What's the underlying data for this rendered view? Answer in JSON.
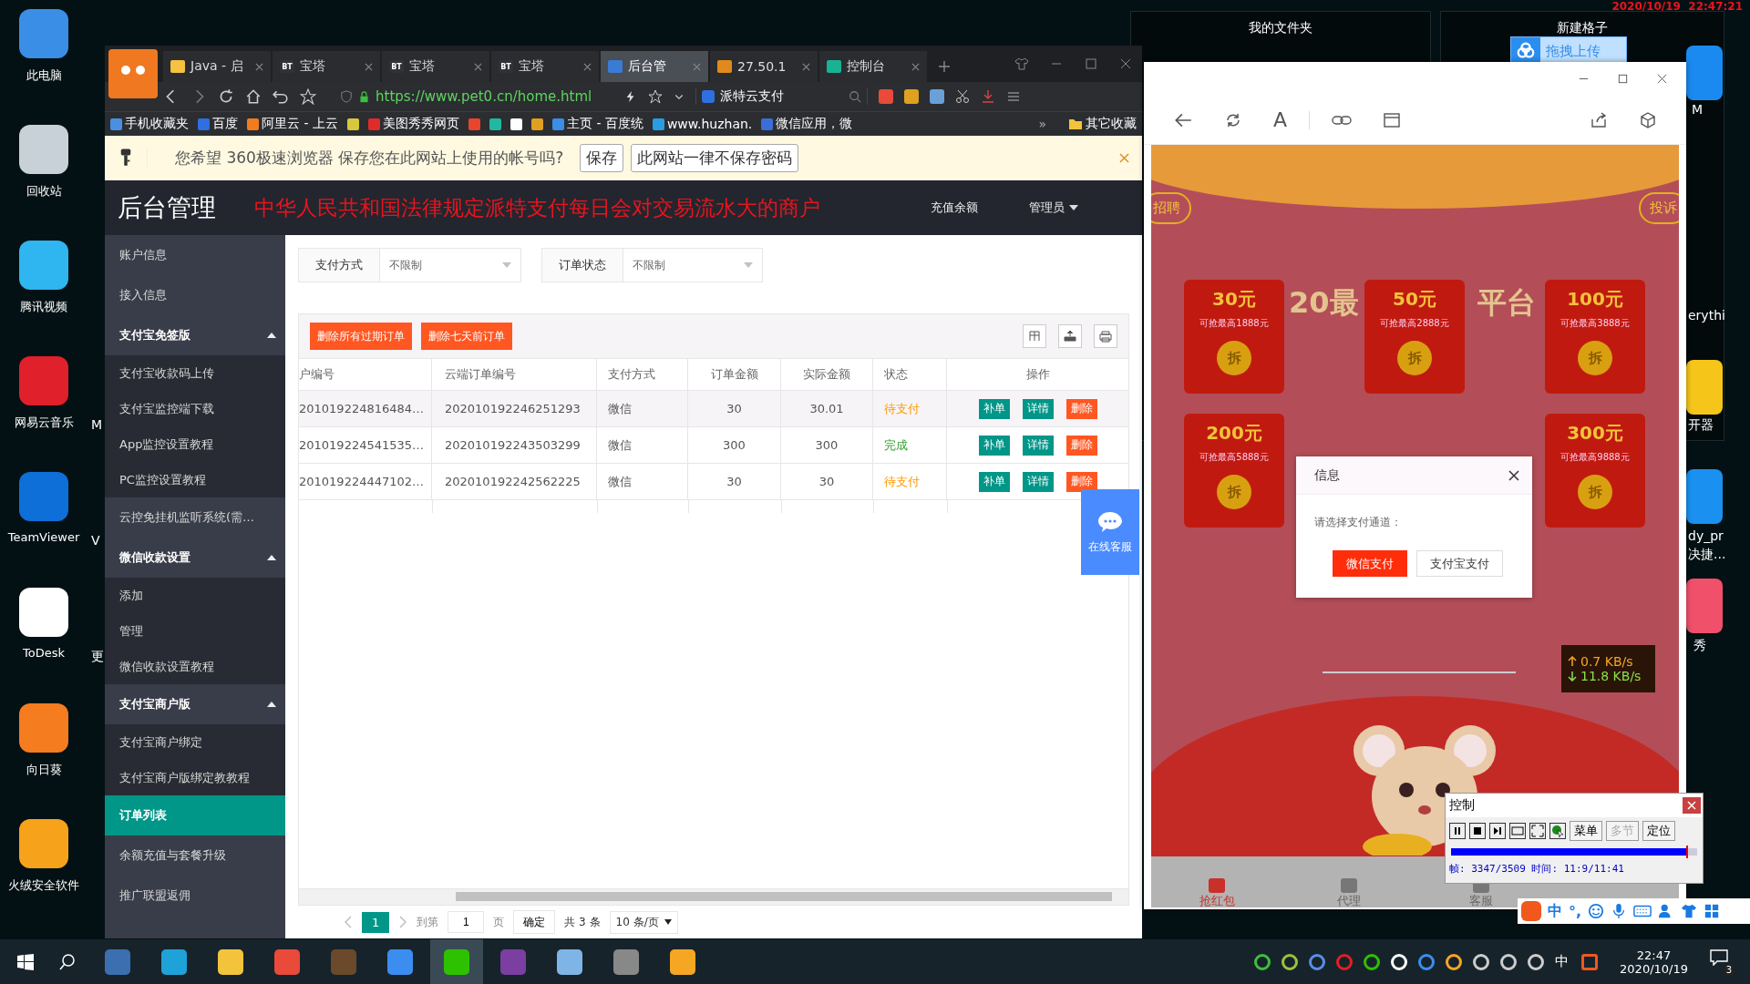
{
  "desktop": {
    "icons": [
      {
        "label": "此电脑",
        "kind": "pc"
      },
      {
        "label": "回收站",
        "kind": "bin"
      },
      {
        "label": "腾讯视频",
        "kind": "video"
      },
      {
        "label": "网易云音乐",
        "kind": "music"
      },
      {
        "label": "TeamViewer",
        "kind": "remote"
      },
      {
        "label": "ToDesk",
        "kind": "desk"
      },
      {
        "label": "向日葵",
        "kind": "sun"
      },
      {
        "label": "火绒安全软件",
        "kind": "shield"
      }
    ],
    "left_fragments": [
      "M",
      "V",
      "更"
    ],
    "right_fragments": [
      "M",
      "erythi",
      "开器",
      "dy_pr",
      "决捷...",
      "秀"
    ],
    "clock_overlay": "2020/10/19  22:47:21",
    "panels": [
      {
        "title": "我的文件夹"
      },
      {
        "title": "新建格子"
      }
    ],
    "upload_button": "拖拽上传"
  },
  "browser": {
    "tabs": [
      {
        "label": "Java - 启",
        "kind": "java",
        "selected": false
      },
      {
        "label": "宝塔",
        "kind": "bt",
        "icon_text": "BT",
        "selected": false
      },
      {
        "label": "宝塔",
        "kind": "bt",
        "icon_text": "BT",
        "selected": false
      },
      {
        "label": "宝塔",
        "kind": "bt",
        "icon_text": "BT",
        "selected": false
      },
      {
        "label": "后台管",
        "kind": "pay",
        "selected": true
      },
      {
        "label": "27.50.1",
        "kind": "peak",
        "selected": false
      },
      {
        "label": "控制台",
        "kind": "bolt",
        "selected": false
      }
    ],
    "url": "https://www.pet0.cn/home.html",
    "search": "派特云支付",
    "bookmarks": [
      {
        "kind": "phone",
        "label": "手机收藏夹"
      },
      {
        "kind": "paw",
        "label": "百度"
      },
      {
        "kind": "cloud",
        "label": "阿里云 - 上云"
      },
      {
        "kind": "gem"
      },
      {
        "kind": "seal",
        "label": "美图秀秀网页"
      },
      {
        "kind": "skull"
      },
      {
        "kind": "leaf"
      },
      {
        "kind": "page"
      },
      {
        "kind": "cube"
      },
      {
        "kind": "chart",
        "label": "主页 - 百度统"
      },
      {
        "kind": "site",
        "label": "www.huzhan."
      },
      {
        "kind": "letter",
        "label": "微信应用，微"
      }
    ],
    "more": "»",
    "other_bookmarks": "其它收藏",
    "save_prompt": {
      "message": "您希望 360极速浏览器 保存您在此网站上使用的帐号吗?",
      "buttons": [
        "保存",
        "此网站一律不保存密码"
      ]
    }
  },
  "app": {
    "title": "后台管理",
    "notice": "中华人民共和国法律规定派特支付每日会对交易流水大的商户",
    "header_links": [
      "充值余额"
    ],
    "user": "管理员",
    "sidebar": [
      {
        "label": "账户信息",
        "selected": false
      },
      {
        "label": "接入信息",
        "selected": false
      },
      {
        "label": "支付宝免签版",
        "selected": false,
        "expanded": true,
        "children": [
          {
            "label": "支付宝收款码上传",
            "selected": false
          },
          {
            "label": "支付宝监控端下载",
            "selected": false
          },
          {
            "label": "App监控设置教程",
            "selected": false
          },
          {
            "label": "PC监控设置教程",
            "selected": false
          }
        ]
      },
      {
        "label": "云控免挂机监听系统(需…",
        "selected": false
      },
      {
        "label": "微信收款设置",
        "selected": false,
        "expanded": true,
        "children": [
          {
            "label": "添加",
            "selected": false
          },
          {
            "label": "管理",
            "selected": false
          },
          {
            "label": "微信收款设置教程",
            "selected": false
          }
        ]
      },
      {
        "label": "支付宝商户版",
        "selected": false,
        "expanded": true,
        "children": [
          {
            "label": "支付宝商户绑定",
            "selected": false
          },
          {
            "label": "支付宝商户版绑定教教程",
            "selected": false
          }
        ]
      },
      {
        "label": "订单列表",
        "selected": true
      },
      {
        "label": "余额充值与套餐升级",
        "selected": false
      },
      {
        "label": "推广联盟返佣",
        "selected": false
      }
    ],
    "filters": [
      {
        "label": "支付方式",
        "value": "不限制"
      },
      {
        "label": "订单状态",
        "value": "不限制"
      }
    ],
    "actions": [
      "删除所有过期订单",
      "删除七天前订单"
    ],
    "table": {
      "columns": [
        "户编号",
        "云端订单编号",
        "支付方式",
        "订单金额",
        "实际金额",
        "状态",
        "操作"
      ],
      "rows": [
        {
          "cells": [
            "201019224816484…",
            "202010192246251293",
            "微信",
            "30",
            "30.01"
          ],
          "status": {
            "text": "待支付",
            "kind": "pending"
          },
          "actions": [
            {
              "label": "补单",
              "kind": "supplement"
            },
            {
              "label": "详情",
              "kind": "detail"
            },
            {
              "label": "删除",
              "kind": "delete"
            }
          ]
        },
        {
          "cells": [
            "201019224541535…",
            "202010192243503299",
            "微信",
            "300",
            "300"
          ],
          "status": {
            "text": "完成",
            "kind": "done"
          },
          "actions": [
            {
              "label": "补单",
              "kind": "supplement"
            },
            {
              "label": "详情",
              "kind": "detail"
            },
            {
              "label": "删除",
              "kind": "delete"
            }
          ]
        },
        {
          "cells": [
            "201019224447102…",
            "202010192242562225",
            "微信",
            "30",
            "30"
          ],
          "status": {
            "text": "待支付",
            "kind": "pending"
          },
          "actions": [
            {
              "label": "补单",
              "kind": "supplement"
            },
            {
              "label": "详情",
              "kind": "detail"
            },
            {
              "label": "删除",
              "kind": "delete"
            }
          ]
        }
      ]
    },
    "pagination": {
      "current": "1",
      "goto_label": "到第",
      "goto_value": "1",
      "page_unit": "页",
      "confirm": "确定",
      "total": "共 3 条",
      "page_size": "10 条/页"
    },
    "support": "在线客服"
  },
  "phone_window": {
    "text_size_glyph": "A",
    "pills": [
      "招聘",
      "投诉"
    ],
    "banner_fragments": [
      "20最",
      "平台"
    ],
    "envelopes": [
      {
        "amount": "30元",
        "note": "可抢最高1888元",
        "open": "拆"
      },
      {
        "amount": "50元",
        "note": "可抢最高2888元",
        "open": "拆"
      },
      {
        "amount": "100元",
        "note": "可抢最高3888元",
        "open": "拆"
      },
      {
        "amount": "200元",
        "note": "可抢最高5888元",
        "open": "拆"
      },
      {
        "amount": "300元",
        "note": "可抢最高9888元",
        "open": "拆"
      }
    ],
    "dialog": {
      "title": "信息",
      "message": "请选择支付通道：",
      "buttons": [
        {
          "label": "微信支付",
          "kind": "primary"
        },
        {
          "label": "支付宝支付",
          "kind": "default"
        }
      ]
    },
    "nav": [
      {
        "label": "抢红包",
        "selected": true
      },
      {
        "label": "代理",
        "selected": false
      },
      {
        "label": "客服",
        "selected": false
      }
    ]
  },
  "speed": {
    "up": "0.7 KB/s",
    "down": "11.8 KB/s"
  },
  "player_control": {
    "title": "控制",
    "buttons": [
      {
        "label": "菜单",
        "disabled": false
      },
      {
        "label": "多节",
        "disabled": true
      },
      {
        "label": "定位",
        "disabled": false
      }
    ],
    "level": 0.954,
    "status": "帧: 3347/3509 时间: 11:9/11:41"
  },
  "ime_bar": {
    "mode": "中",
    "punct": "°,"
  },
  "taskbar": {
    "pinned": [
      {
        "kind": "monitor",
        "selected": false
      },
      {
        "kind": "browser",
        "selected": false
      },
      {
        "kind": "folder",
        "selected": false
      },
      {
        "kind": "wheel",
        "selected": false
      },
      {
        "kind": "photo",
        "selected": false
      },
      {
        "kind": "cloud",
        "selected": false
      },
      {
        "kind": "chat",
        "selected": true
      },
      {
        "kind": "box",
        "selected": false
      },
      {
        "kind": "pad",
        "selected": false
      },
      {
        "kind": "camera",
        "selected": false
      },
      {
        "kind": "note",
        "selected": false
      }
    ],
    "ime": "中",
    "time": "22:47",
    "date": "2020/10/19",
    "notifications": "3"
  }
}
